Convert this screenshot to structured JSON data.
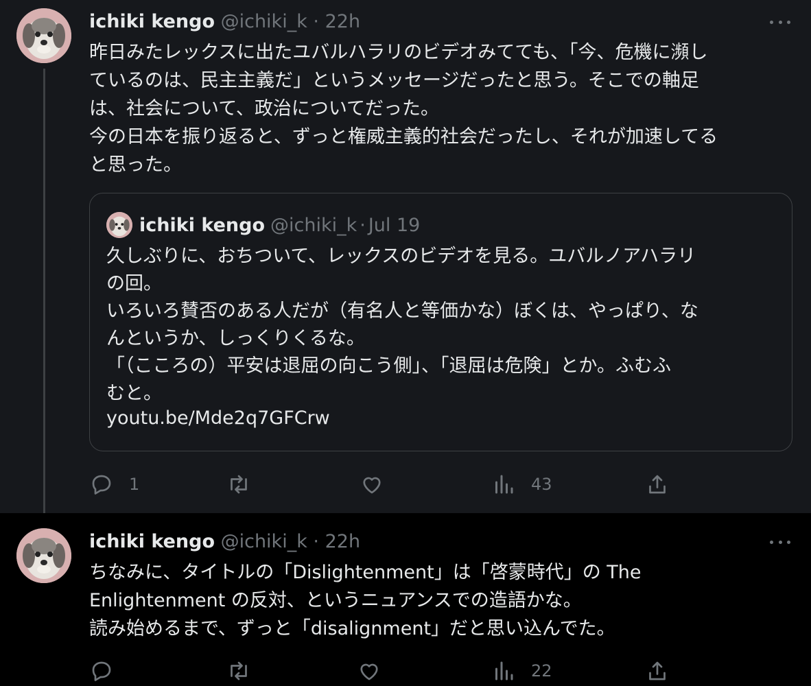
{
  "tweets": [
    {
      "name": "ichiki kengo",
      "handle": "@ichiki_k",
      "time": "22h",
      "text": "昨日みたレックスに出たユバルハラリのビデオみてても、「今、危機に瀕し\nているのは、民主主義だ」というメッセージだったと思う。そこでの軸足\nは、社会について、政治についてだった。\n今の日本を振り返ると、ずっと権威主義的社会だったし、それが加速してる\nと思った。",
      "quote": {
        "name": "ichiki kengo",
        "handle": "@ichiki_k",
        "time": "Jul 19",
        "text": "久しぶりに、おちついて、レックスのビデオを見る。ユバルノアハラリ\nの回。\nいろいろ賛否のある人だが（有名人と等価かな）ぼくは、やっぱり、な\nんというか、しっくりくるな。\n「（こころの）平安は退屈の向こう側」、「退屈は危険」とか。ふむふ\nむと。",
        "link": "youtu.be/Mde2q7GFCrw"
      },
      "actions": {
        "replies": "1",
        "retweets": "",
        "likes": "",
        "views": "43"
      }
    },
    {
      "name": "ichiki kengo",
      "handle": "@ichiki_k",
      "time": "22h",
      "text": "ちなみに、タイトルの「Dislightenment」は「啓蒙時代」の The\nEnlightenment の反対、というニュアンスでの造語かな。\n読み始めるまで、ずっと「disalignment」だと思い込んでた。",
      "actions": {
        "replies": "",
        "retweets": "",
        "likes": "",
        "views": "22"
      }
    }
  ],
  "separator": "·",
  "icons": {
    "avatar": "dog-avatar",
    "more": "more-icon",
    "reply": "reply-icon",
    "retweet": "retweet-icon",
    "like": "heart-icon",
    "views": "views-icon",
    "share": "share-icon"
  },
  "colors": {
    "background": "#000000",
    "hover_background": "#16181c",
    "text": "#e7e9ea",
    "muted": "#71767b",
    "border": "#3e4144"
  }
}
